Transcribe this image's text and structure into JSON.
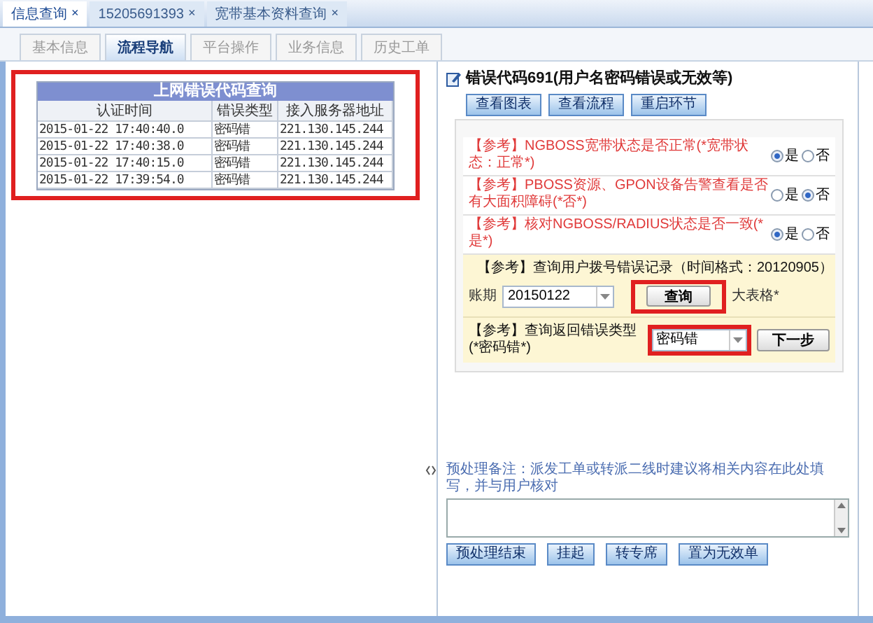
{
  "tabs": [
    {
      "label": "信息查询",
      "close": "×",
      "selected": true
    },
    {
      "label": "15205691393",
      "close": "×",
      "selected": false
    },
    {
      "label": "宽带基本资料查询",
      "close": "×",
      "selected": false
    }
  ],
  "sub_tabs": [
    {
      "label": "基本信息",
      "selected": false
    },
    {
      "label": "流程导航",
      "selected": true
    },
    {
      "label": "平台操作",
      "selected": false
    },
    {
      "label": "业务信息",
      "selected": false
    },
    {
      "label": "历史工单",
      "selected": false
    }
  ],
  "error_table": {
    "highlighted": true,
    "title": "上网错误代码查询",
    "columns": [
      "认证时间",
      "错误类型",
      "接入服务器地址"
    ],
    "rows": [
      [
        "2015-01-22 17:40:40.0",
        "密码错",
        "221.130.145.244"
      ],
      [
        "2015-01-22 17:40:38.0",
        "密码错",
        "221.130.145.244"
      ],
      [
        "2015-01-22 17:40:15.0",
        "密码错",
        "221.130.145.244"
      ],
      [
        "2015-01-22 17:39:54.0",
        "密码错",
        "221.130.145.244"
      ]
    ]
  },
  "panel": {
    "title": "错误代码691(用户名密码错误或无效等)",
    "buttons": [
      "查看图表",
      "查看流程",
      "重启环节"
    ],
    "steps": [
      {
        "kind": "radio",
        "text": "【参考】NGBOSS宽带状态是否正常(*宽带状态：正常*)",
        "options": [
          {
            "label": "是",
            "selected": true
          },
          {
            "label": "否",
            "selected": false
          }
        ]
      },
      {
        "kind": "radio",
        "text": "【参考】PBOSS资源、GPON设备告警查看是否有大面积障碍(*否*)",
        "options": [
          {
            "label": "是",
            "selected": false
          },
          {
            "label": "否",
            "selected": true
          }
        ]
      },
      {
        "kind": "radio",
        "text": "【参考】核对NGBOSS/RADIUS状态是否一致(*是*)",
        "options": [
          {
            "label": "是",
            "selected": true
          },
          {
            "label": "否",
            "selected": false
          }
        ]
      },
      {
        "kind": "query",
        "text": "【参考】查询用户拨号错误记录（时间格式：20120905）",
        "field_label": "账期",
        "value": "20150122",
        "button": "查询",
        "button_highlighted": true,
        "suffix": "大表格*"
      },
      {
        "kind": "select",
        "text": "【参考】查询返回错误类型(*密码错*)",
        "value": "密码错",
        "select_highlighted": true,
        "button": "下一步"
      }
    ],
    "remark_label": "预处理备注：派发工单或转派二线时建议将相关内容在此处填写，并与用户核对",
    "actions": [
      "预处理结束",
      "挂起",
      "转专席",
      "置为无效单"
    ]
  }
}
